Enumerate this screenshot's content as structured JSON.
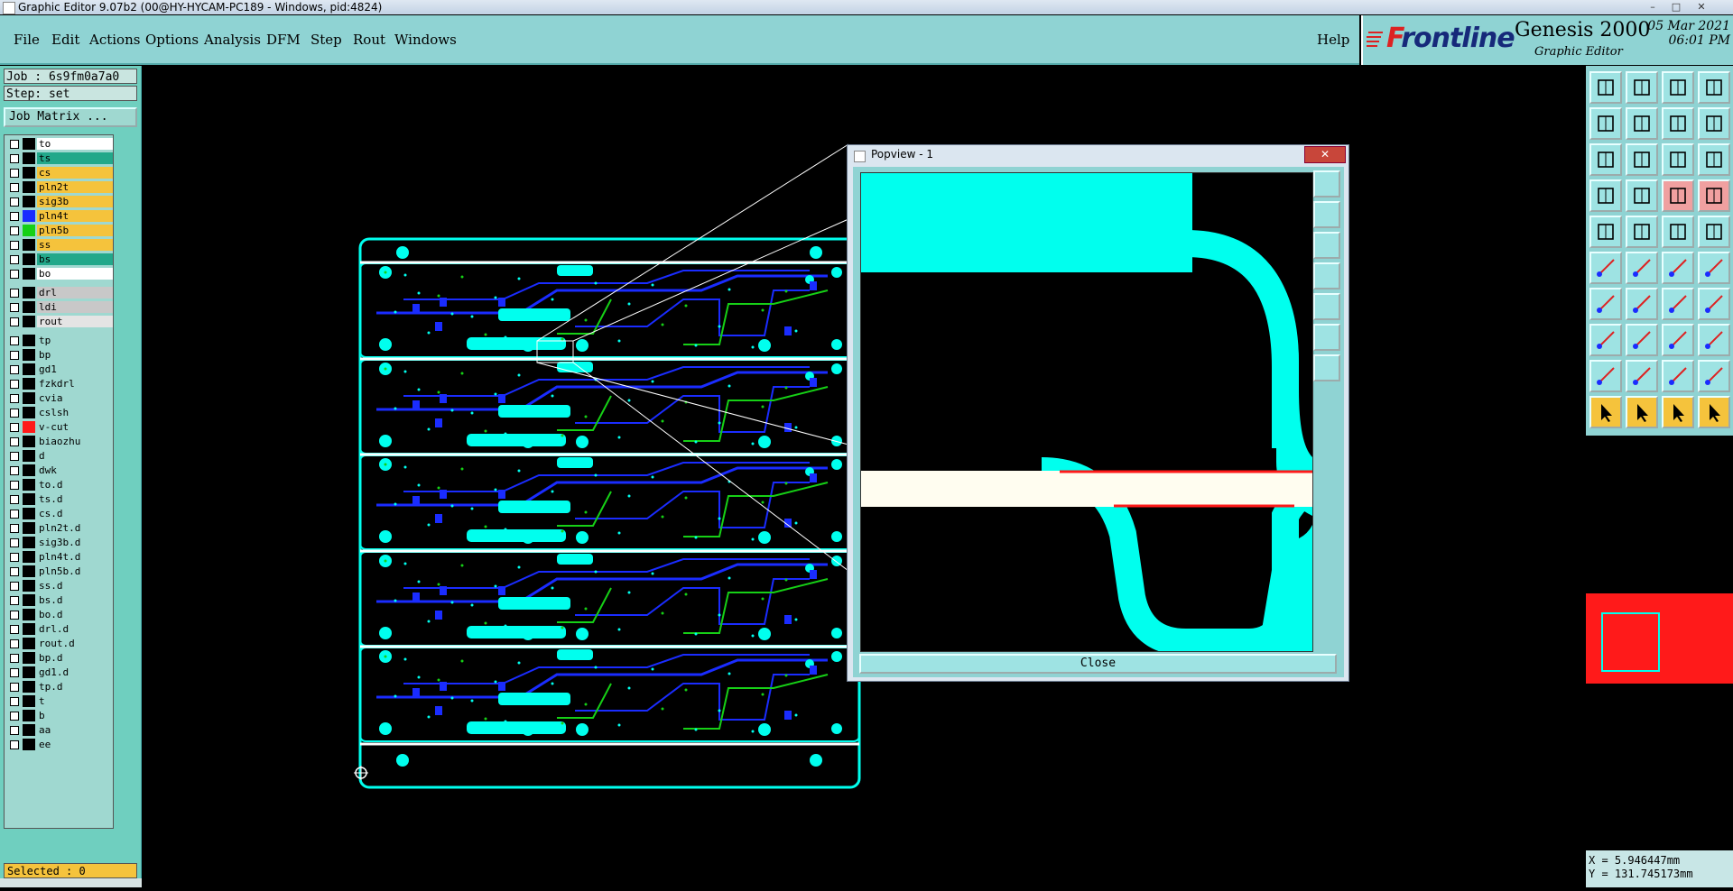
{
  "window": {
    "title": "Graphic Editor 9.07b2 (00@HY-HYCAM-PC189 - Windows, pid:4824)",
    "minimize": "–",
    "maximize": "□",
    "close": "✕"
  },
  "menu": {
    "file": "File",
    "edit": "Edit",
    "actions": "Actions",
    "options": "Options",
    "analysis": "Analysis",
    "dfm": "DFM",
    "step": "Step",
    "rout": "Rout",
    "windows": "Windows",
    "help": "Help"
  },
  "brand": {
    "logo": "Frontline",
    "product": "Genesis 2000",
    "subtitle": "Graphic Editor",
    "date": "05 Mar 2021",
    "time": "06:01 PM"
  },
  "left_panel": {
    "job": "Job : 6s9fm0a7a0",
    "step": "Step: set",
    "job_matrix": "Job Matrix ...",
    "selected": "Selected : 0"
  },
  "layers": [
    {
      "name": "to",
      "bg": "#ffffff",
      "swatch": "#000000"
    },
    {
      "name": "ts",
      "bg": "#22a88a",
      "swatch": "#000000"
    },
    {
      "name": "cs",
      "bg": "#f5c33c",
      "swatch": "#000000"
    },
    {
      "name": "pln2t",
      "bg": "#f5c33c",
      "swatch": "#000000"
    },
    {
      "name": "sig3b",
      "bg": "#f5c33c",
      "swatch": "#000000"
    },
    {
      "name": "pln4t",
      "bg": "#f5c33c",
      "swatch": "#1a2cff"
    },
    {
      "name": "pln5b",
      "bg": "#f5c33c",
      "swatch": "#16d016"
    },
    {
      "name": "ss",
      "bg": "#f5c33c",
      "swatch": "#000000"
    },
    {
      "name": "bs",
      "bg": "#22a88a",
      "swatch": "#000000"
    },
    {
      "name": "bo",
      "bg": "#ffffff",
      "swatch": "#000000"
    },
    {
      "name": "drl",
      "bg": "#c8c8c8",
      "swatch": "#000000"
    },
    {
      "name": "ldi",
      "bg": "#c8c8c8",
      "swatch": "#000000"
    },
    {
      "name": "rout",
      "bg": "#e4e4e4",
      "swatch": "#000000"
    },
    {
      "name": "tp",
      "bg": "#9fd8d0",
      "swatch": "#000000"
    },
    {
      "name": "bp",
      "bg": "#9fd8d0",
      "swatch": "#000000"
    },
    {
      "name": "gd1",
      "bg": "#9fd8d0",
      "swatch": "#000000"
    },
    {
      "name": "fzkdrl",
      "bg": "#9fd8d0",
      "swatch": "#000000"
    },
    {
      "name": "cvia",
      "bg": "#9fd8d0",
      "swatch": "#000000"
    },
    {
      "name": "cslsh",
      "bg": "#9fd8d0",
      "swatch": "#000000"
    },
    {
      "name": "v-cut",
      "bg": "#9fd8d0",
      "swatch": "#ff1a1a"
    },
    {
      "name": "biaozhu",
      "bg": "#9fd8d0",
      "swatch": "#000000"
    },
    {
      "name": "d",
      "bg": "#9fd8d0",
      "swatch": "#000000"
    },
    {
      "name": "dwk",
      "bg": "#9fd8d0",
      "swatch": "#000000"
    },
    {
      "name": "to.d",
      "bg": "#9fd8d0",
      "swatch": "#000000"
    },
    {
      "name": "ts.d",
      "bg": "#9fd8d0",
      "swatch": "#000000"
    },
    {
      "name": "cs.d",
      "bg": "#9fd8d0",
      "swatch": "#000000"
    },
    {
      "name": "pln2t.d",
      "bg": "#9fd8d0",
      "swatch": "#000000"
    },
    {
      "name": "sig3b.d",
      "bg": "#9fd8d0",
      "swatch": "#000000"
    },
    {
      "name": "pln4t.d",
      "bg": "#9fd8d0",
      "swatch": "#000000"
    },
    {
      "name": "pln5b.d",
      "bg": "#9fd8d0",
      "swatch": "#000000"
    },
    {
      "name": "ss.d",
      "bg": "#9fd8d0",
      "swatch": "#000000"
    },
    {
      "name": "bs.d",
      "bg": "#9fd8d0",
      "swatch": "#000000"
    },
    {
      "name": "bo.d",
      "bg": "#9fd8d0",
      "swatch": "#000000"
    },
    {
      "name": "drl.d",
      "bg": "#9fd8d0",
      "swatch": "#000000"
    },
    {
      "name": "rout.d",
      "bg": "#9fd8d0",
      "swatch": "#000000"
    },
    {
      "name": "bp.d",
      "bg": "#9fd8d0",
      "swatch": "#000000"
    },
    {
      "name": "gd1.d",
      "bg": "#9fd8d0",
      "swatch": "#000000"
    },
    {
      "name": "tp.d",
      "bg": "#9fd8d0",
      "swatch": "#000000"
    },
    {
      "name": "t",
      "bg": "#9fd8d0",
      "swatch": "#000000"
    },
    {
      "name": "b",
      "bg": "#9fd8d0",
      "swatch": "#000000"
    },
    {
      "name": "aa",
      "bg": "#9fd8d0",
      "swatch": "#000000"
    },
    {
      "name": "ee",
      "bg": "#9fd8d0",
      "swatch": "#000000"
    }
  ],
  "popview": {
    "title": "Popview - 1",
    "close_button": "Close"
  },
  "coords": {
    "x": "X = 5.946447mm",
    "y": "Y = 131.745173mm"
  },
  "colors": {
    "panel": "#8fd3d3",
    "copper": "#00ffee",
    "trace_blue": "#1a2cff",
    "trace_green": "#16d016",
    "vcut_red": "#ff1a1a"
  }
}
